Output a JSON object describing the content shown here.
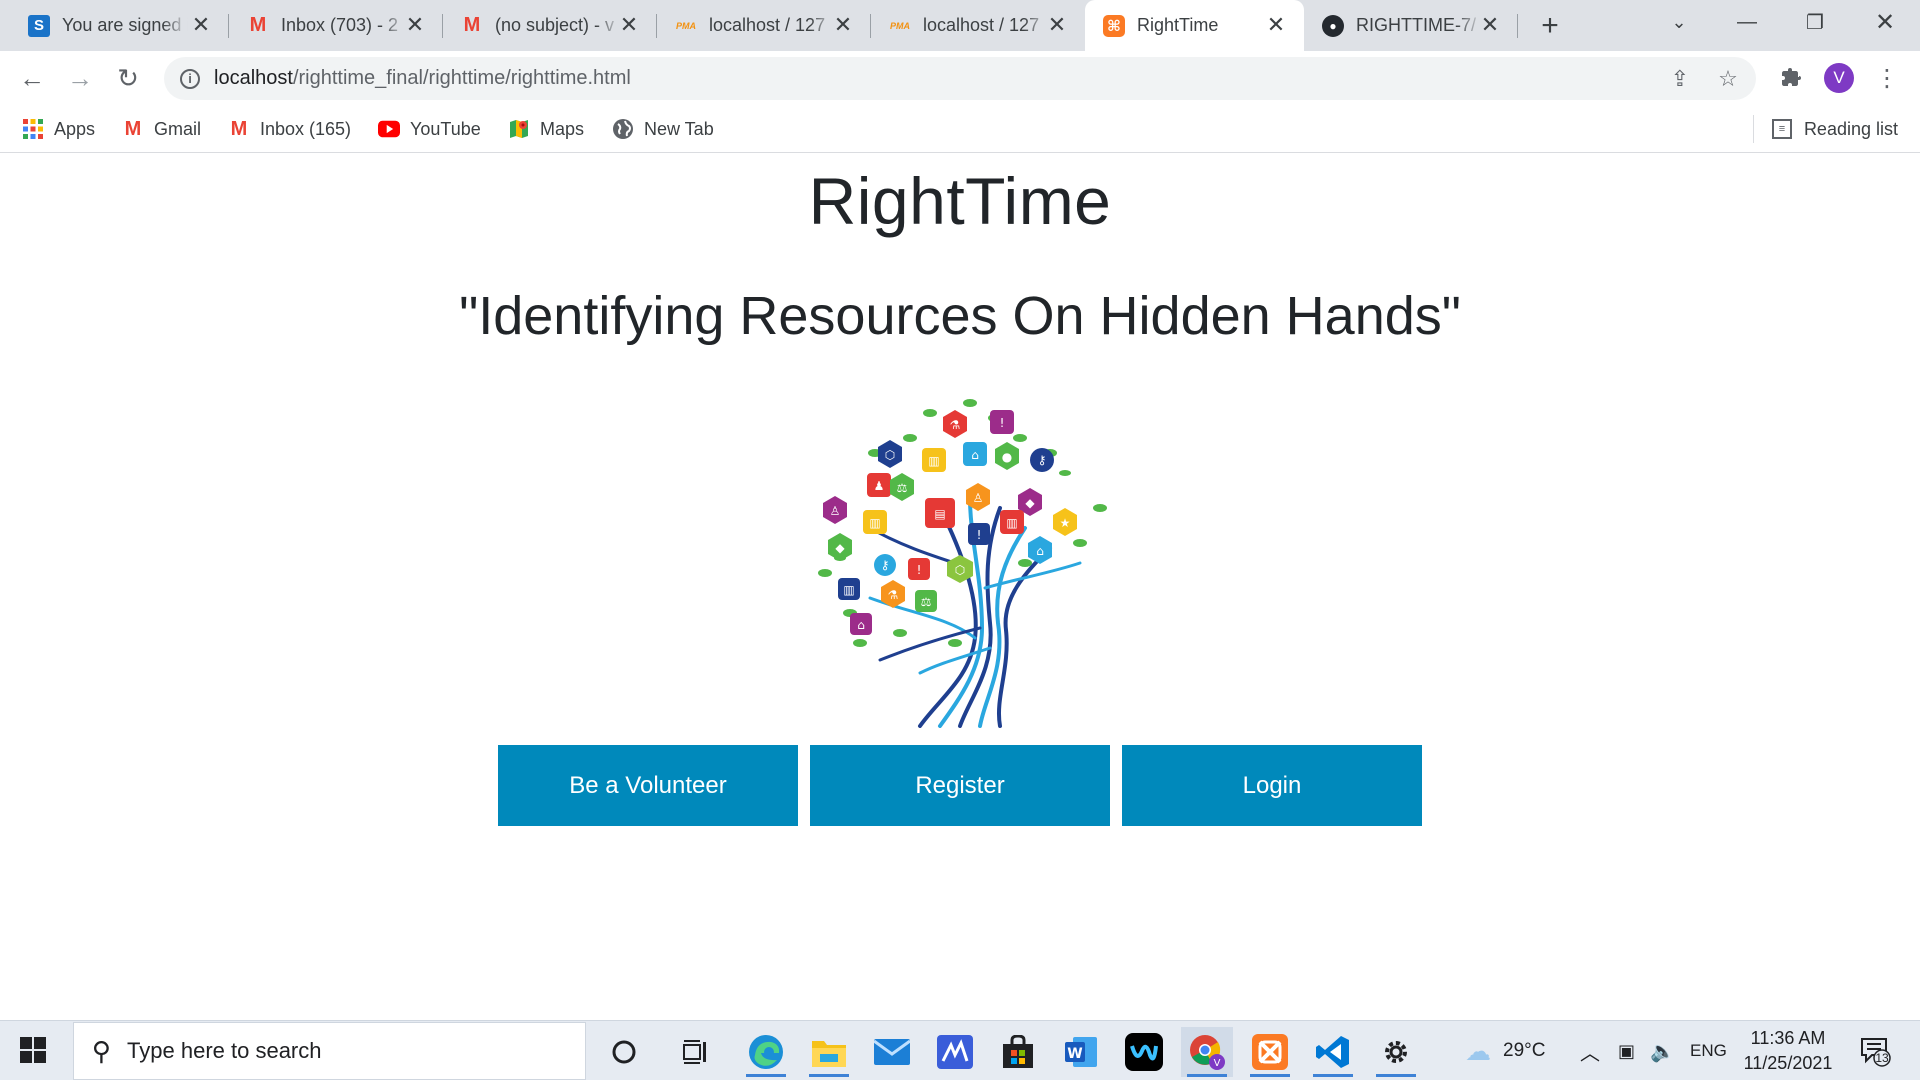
{
  "browser": {
    "tabs": [
      {
        "title": "You are signed in",
        "favicon": "s-letter-icon",
        "favicon_color": "#1a73c8",
        "favicon_text": "S"
      },
      {
        "title": "Inbox (703) - 2",
        "favicon": "gmail-icon",
        "favicon_color": "#ea4335",
        "favicon_text": "M"
      },
      {
        "title": "(no subject) - v",
        "favicon": "gmail-icon",
        "favicon_color": "#ea4335",
        "favicon_text": "M"
      },
      {
        "title": "localhost / 127",
        "favicon": "phpmyadmin-icon",
        "favicon_color": "#f29111",
        "favicon_text": "PMA"
      },
      {
        "title": "localhost / 127",
        "favicon": "phpmyadmin-icon",
        "favicon_color": "#f29111",
        "favicon_text": "PMA"
      },
      {
        "title": "RightTime",
        "favicon": "xampp-icon",
        "favicon_color": "#fb7a24",
        "favicon_text": "⌘",
        "active": true
      },
      {
        "title": "RIGHTTIME-7/",
        "favicon": "github-icon",
        "favicon_color": "#24292f",
        "favicon_text": "●"
      }
    ],
    "url_host": "localhost",
    "url_path": "/righttime_final/righttime/righttime.html",
    "profile_initial": "V",
    "bookmarks": [
      {
        "label": "Apps",
        "icon": "apps-grid-icon"
      },
      {
        "label": "Gmail",
        "icon": "gmail-icon"
      },
      {
        "label": "Inbox (165)",
        "icon": "gmail-icon"
      },
      {
        "label": "YouTube",
        "icon": "youtube-icon"
      },
      {
        "label": "Maps",
        "icon": "maps-icon"
      },
      {
        "label": "New Tab",
        "icon": "globe-icon"
      }
    ],
    "reading_list": "Reading list"
  },
  "page": {
    "title": "RightTime",
    "tagline": "\"Identifying Resources On Hidden Hands\"",
    "buttons": {
      "volunteer": "Be a Volunteer",
      "register": "Register",
      "login": "Login"
    },
    "button_color": "#0089bb"
  },
  "taskbar": {
    "search_placeholder": "Type here to search",
    "weather": "29°C",
    "language": "ENG",
    "time": "11:36 AM",
    "date": "11/25/2021",
    "notifications": "13"
  }
}
